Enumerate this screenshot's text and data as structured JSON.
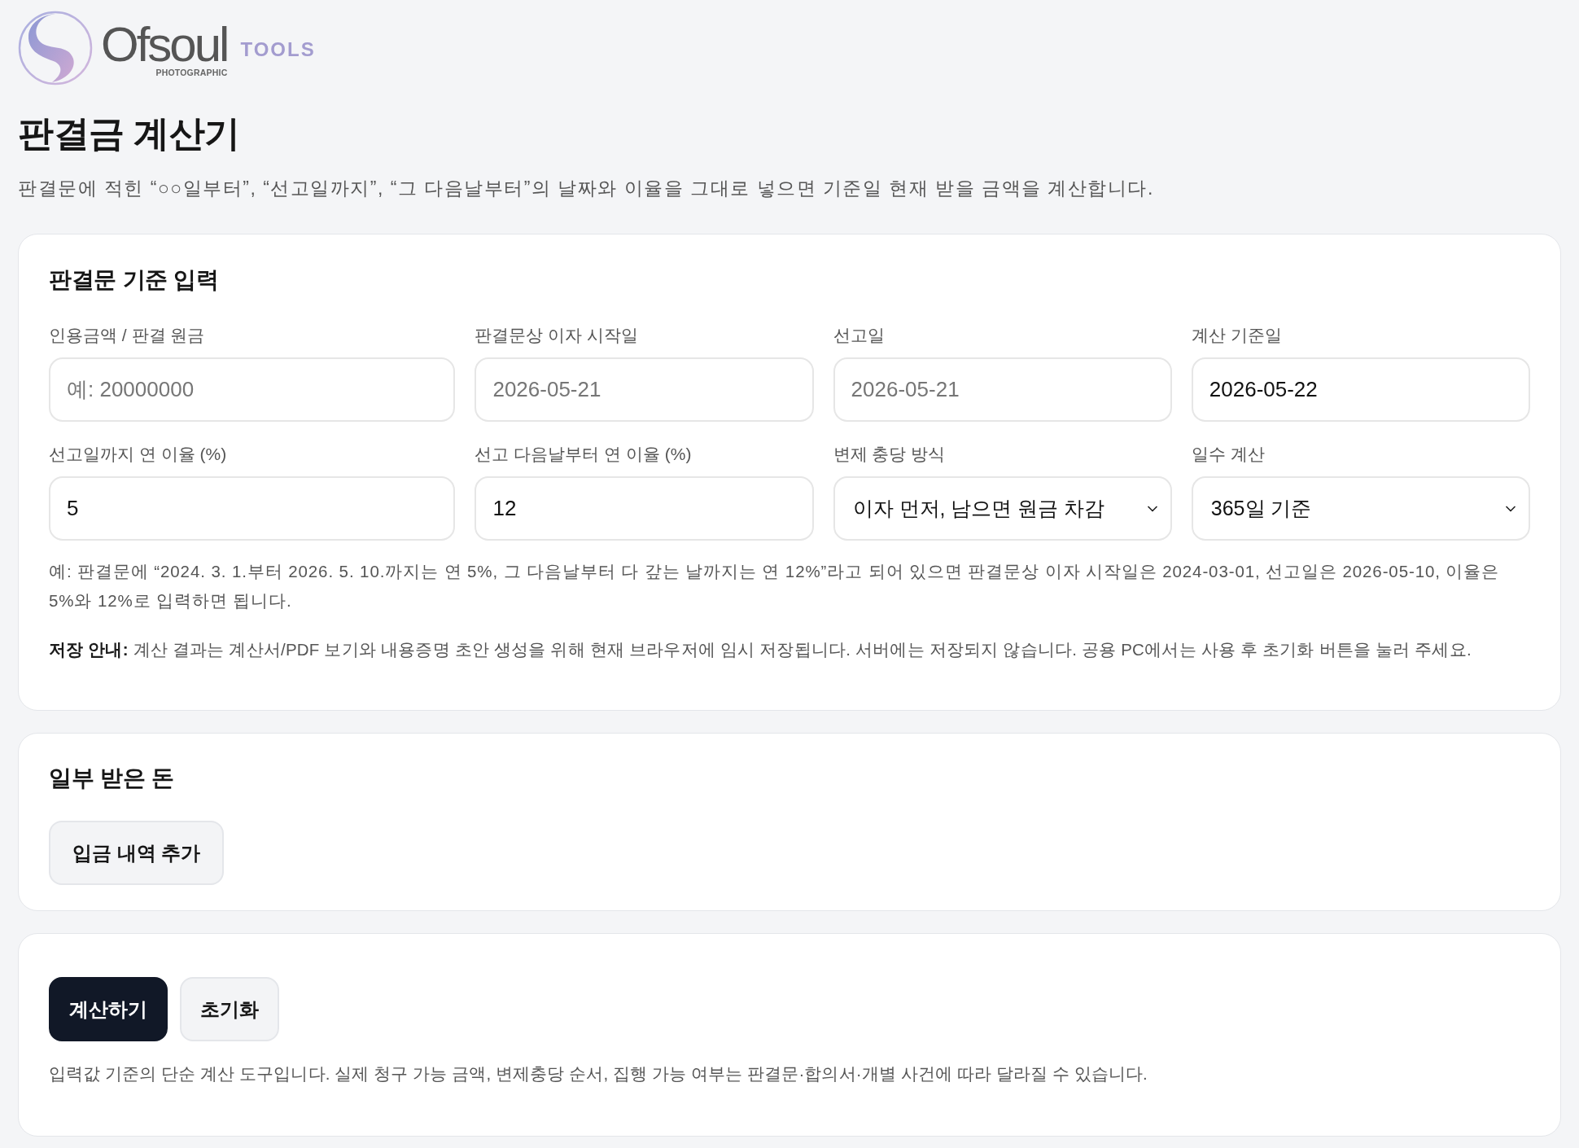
{
  "brand": {
    "wordmark": "Ofsoul",
    "tagline": "PHOTOGRAPHIC",
    "badge": "TOOLS"
  },
  "page": {
    "title": "판결금 계산기",
    "subtitle": "판결문에 적힌 “○○일부터”, “선고일까지”, “그 다음날부터”의 날짜와 이율을 그대로 넣으면 기준일 현재 받을 금액을 계산합니다."
  },
  "judgment_card": {
    "title": "판결문 기준 입력",
    "fields": [
      {
        "kind": "input",
        "label": "인용금액 / 판결 원금",
        "placeholder": "예: 20000000"
      },
      {
        "kind": "input",
        "label": "판결문상 이자 시작일",
        "placeholder": "2026-05-21"
      },
      {
        "kind": "input",
        "label": "선고일",
        "placeholder": "2026-05-21"
      },
      {
        "kind": "input",
        "label": "계산 기준일",
        "value": "2026-05-22"
      },
      {
        "kind": "input",
        "label": "선고일까지 연 이율 (%)",
        "value": "5"
      },
      {
        "kind": "input",
        "label": "선고 다음날부터 연 이율 (%)",
        "value": "12"
      },
      {
        "kind": "select",
        "label": "변제 충당 방식",
        "value": "이자 먼저, 남으면 원금 차감"
      },
      {
        "kind": "select",
        "label": "일수 계산",
        "value": "365일 기준"
      }
    ],
    "example_note": "예: 판결문에 “2024. 3. 1.부터 2026. 5. 10.까지는 연 5%, 그 다음날부터 다 갚는 날까지는 연 12%”라고 되어 있으면 판결문상 이자 시작일은 2024-03-01, 선고일은 2026-05-10, 이율은 5%와 12%로 입력하면 됩니다.",
    "storage_note": "**저장 안내:** 계산 결과는 계산서/PDF 보기와 내용증명 초안 생성을 위해 현재 브라우저에 임시 저장됩니다. 서버에는 저장되지 않습니다. 공용 PC에서는 사용 후 초기화 버튼을 눌러 주세요."
  },
  "payments_card": {
    "title": "일부 받은 돈",
    "add_button": "입금 내역 추가"
  },
  "actions_card": {
    "buttons": [
      {
        "kind": "primary",
        "label": "계산하기"
      },
      {
        "kind": "secondary",
        "label": "초기화"
      }
    ],
    "disclaimer": "입력값 기준의 단순 계산 도구입니다. 실제 청구 가능 금액, 변제충당 순서, 집행 가능 여부는 판결문·합의서·개별 사건에 따라 달라질 수 있습니다."
  }
}
